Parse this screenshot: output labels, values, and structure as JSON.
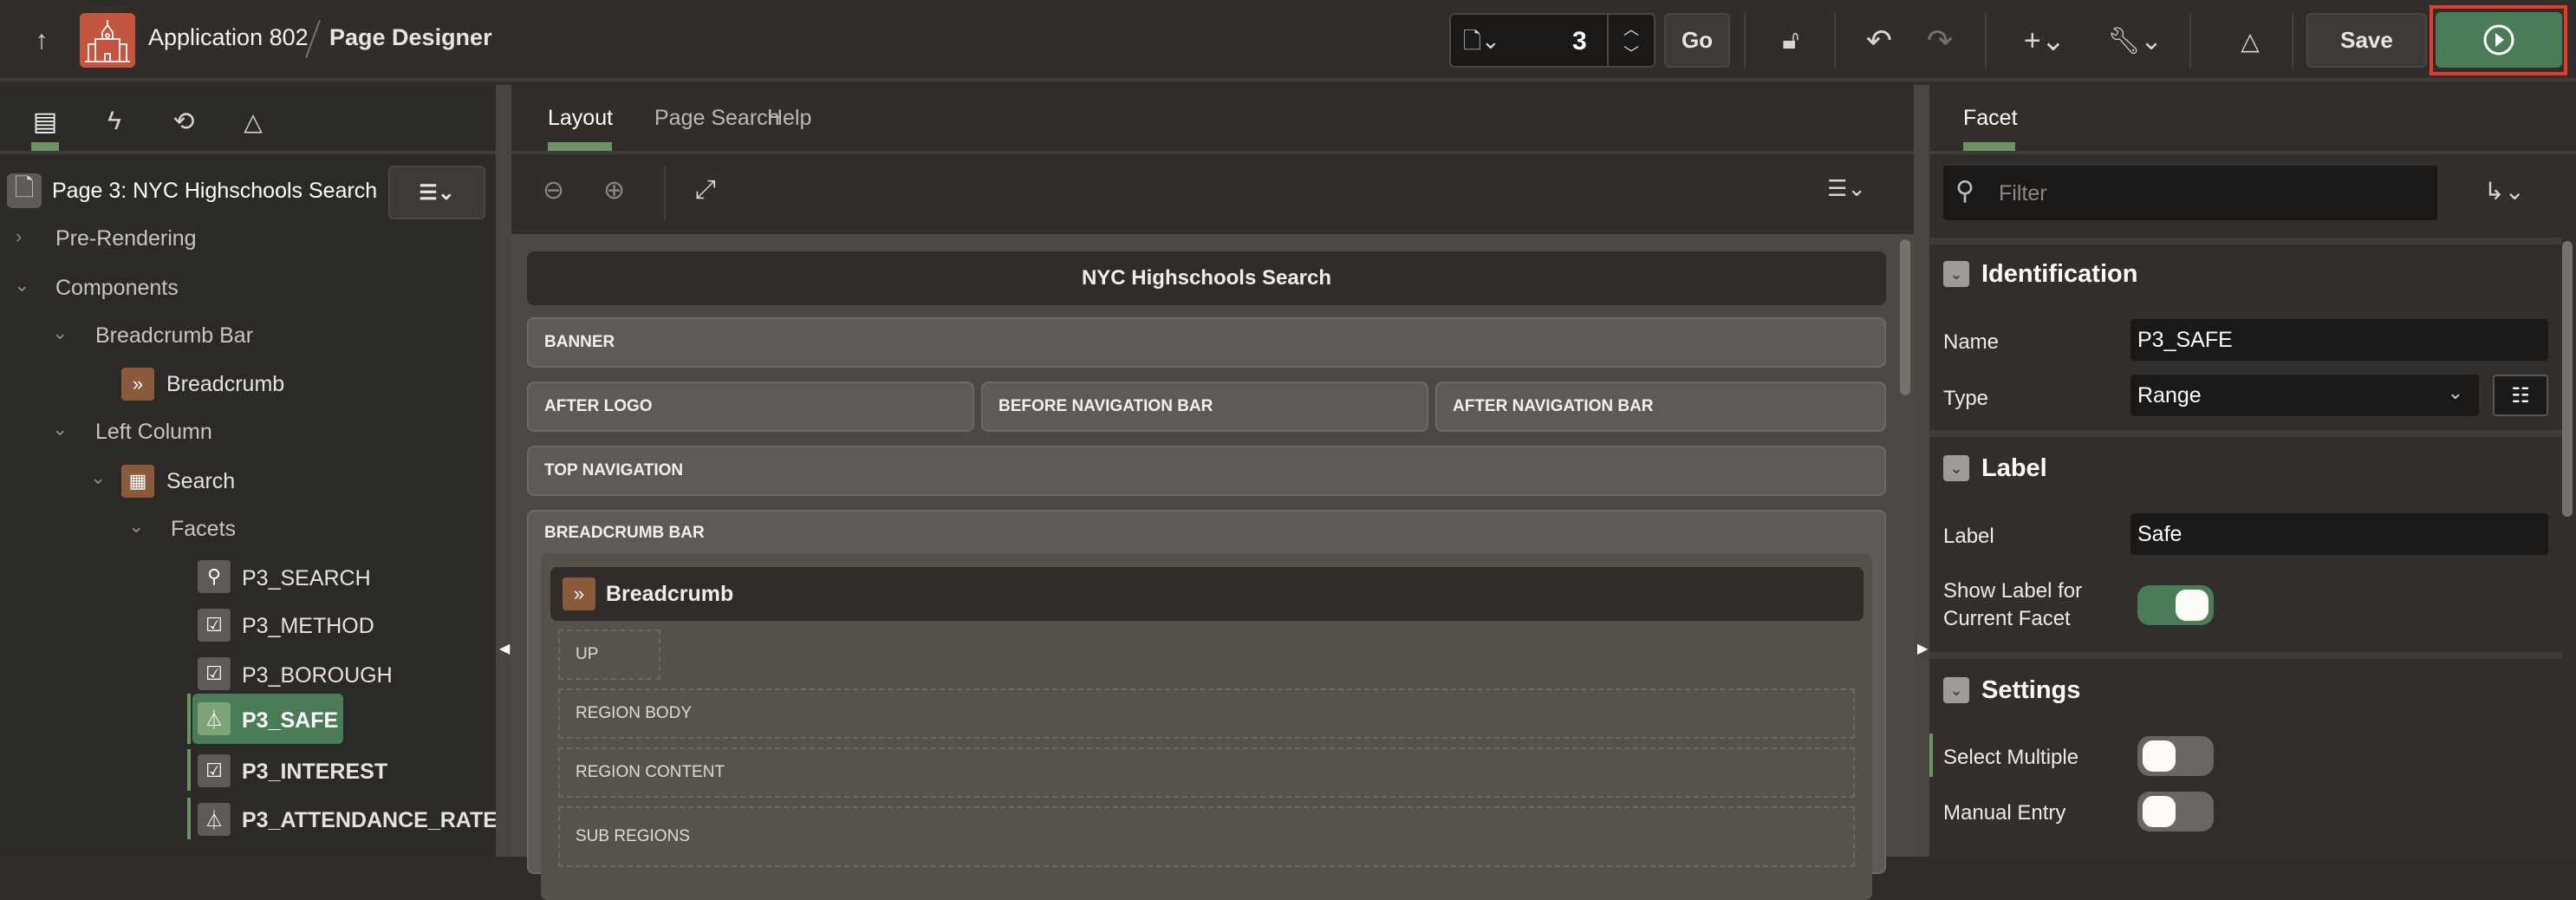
{
  "header": {
    "app_name": "Application 802",
    "page_designer": "Page Designer",
    "page_number": "3",
    "go_label": "Go",
    "save_label": "Save",
    "icons": [
      "up-arrow-icon",
      "app-logo-icon",
      "page-icon",
      "lock-icon",
      "undo-icon",
      "redo-icon",
      "plus-icon",
      "wrench-icon",
      "shapes-icon",
      "run-icon"
    ]
  },
  "left": {
    "tabs": [
      "rendering-icon",
      "dynamic-actions-icon",
      "processing-icon",
      "shared-components-icon"
    ],
    "page_title": "Page 3: NYC Highschools Search",
    "tree": [
      {
        "label": "Pre-Rendering"
      },
      {
        "label": "Components"
      },
      {
        "label": "Breadcrumb Bar"
      },
      {
        "label": "Breadcrumb"
      },
      {
        "label": "Left Column"
      },
      {
        "label": "Search"
      },
      {
        "label": "Facets"
      },
      {
        "label": "P3_SEARCH"
      },
      {
        "label": "P3_METHOD"
      },
      {
        "label": "P3_BOROUGH"
      },
      {
        "label": "P3_SAFE"
      },
      {
        "label": "P3_INTEREST"
      },
      {
        "label": "P3_ATTENDANCE_RATE"
      }
    ]
  },
  "center": {
    "tabs": [
      "Layout",
      "Page Search",
      "Help"
    ],
    "page_title": "NYC Highschools Search",
    "regions": {
      "banner": "BANNER",
      "after_logo": "AFTER LOGO",
      "before_nav": "BEFORE NAVIGATION BAR",
      "after_nav": "AFTER NAVIGATION BAR",
      "top_nav": "TOP NAVIGATION",
      "breadcrumb_bar": "BREADCRUMB BAR",
      "breadcrumb": "Breadcrumb",
      "up": "UP",
      "region_body": "REGION BODY",
      "region_content": "REGION CONTENT",
      "sub_regions": "SUB REGIONS"
    }
  },
  "right": {
    "tab": "Facet",
    "filter_placeholder": "Filter",
    "identification": {
      "title": "Identification",
      "name_label": "Name",
      "name_value": "P3_SAFE",
      "type_label": "Type",
      "type_value": "Range"
    },
    "label": {
      "title": "Label",
      "label_label": "Label",
      "label_value": "Safe",
      "show_label_1": "Show Label for",
      "show_label_2": "Current Facet",
      "show_label_on": true
    },
    "settings": {
      "title": "Settings",
      "select_multiple": "Select Multiple",
      "manual_entry": "Manual Entry",
      "select_multiple_on": false,
      "manual_entry_on": false
    }
  },
  "colors": {
    "accent_green": "#4a7d57",
    "logo": "#c4553f",
    "highlight_outline": "#e03c2a"
  }
}
